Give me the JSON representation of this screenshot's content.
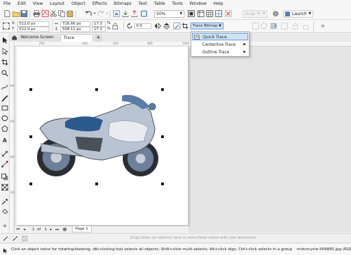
{
  "menu": [
    "File",
    "Edit",
    "View",
    "Layout",
    "Object",
    "Effects",
    "Bitmaps",
    "Text",
    "Table",
    "Tools",
    "Window",
    "Help"
  ],
  "toolbar": {
    "zoom": "50%",
    "snap_to": "Snap To",
    "launch": "Launch"
  },
  "property_bar": {
    "x_label": "X:",
    "x_value": "512.0 px",
    "y_label": "Y:",
    "y_value": "512.0 px",
    "width_value": "716.66 px",
    "height_value": "508.11 px",
    "scale_x": "17.3",
    "scale_y": "17.3",
    "percent": "%",
    "rotation": "0.0",
    "trace_bitmap_label": "Trace Bitmap"
  },
  "tabs": [
    {
      "label": "Welcome Screen"
    },
    {
      "label": "Trace Image*"
    },
    {
      "label": "+"
    }
  ],
  "dropdown": {
    "items": [
      {
        "label": "Quick Trace",
        "submenu": false
      },
      {
        "label": "Centerline Trace",
        "submenu": true
      },
      {
        "label": "Outline Trace",
        "submenu": true
      }
    ]
  },
  "ruler": {
    "top_labels": [
      "200",
      "400",
      "600",
      "800",
      "1000",
      "1200"
    ],
    "left_labels": [
      "800",
      "600",
      "400",
      "200"
    ]
  },
  "page_nav": {
    "current": "1",
    "of": "of",
    "total": "1",
    "page_tab": "Page 1"
  },
  "palette_hint": "Drag colors (or objects) here to store these colors with your document",
  "status": {
    "hint": "Click an object twice for rotating/skewing; dbl-clicking tool selects all objects; Shift+click multi-selects; Alt+click digs; Ctrl+click selects in a group",
    "file": "motorcycle-569865.jpg (RGB)"
  },
  "colors": {
    "selection_highlight": "#cfe3f7",
    "selection_border": "#6b9cd4"
  }
}
